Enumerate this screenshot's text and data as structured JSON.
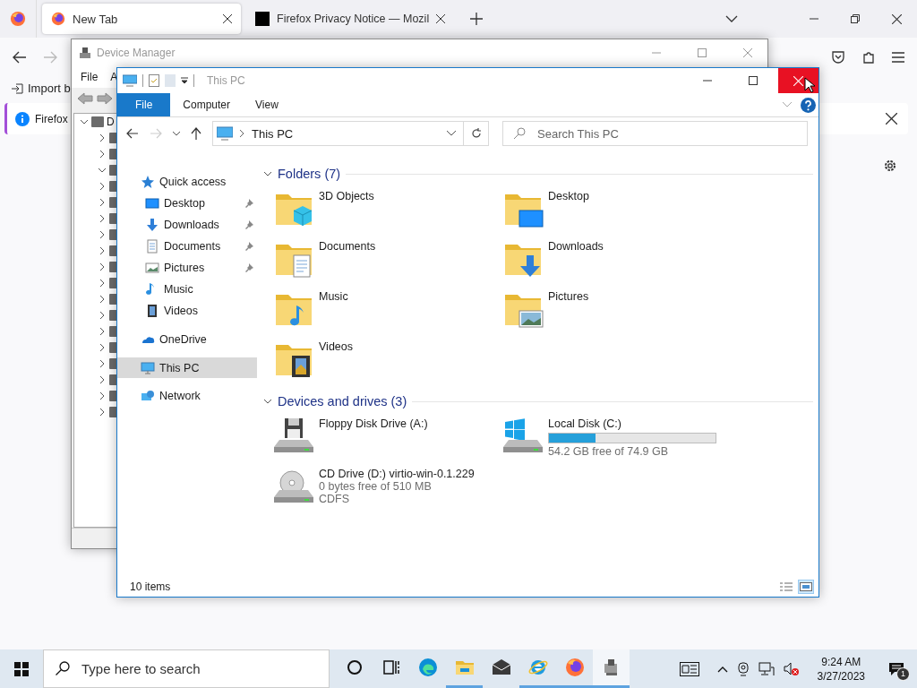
{
  "firefox": {
    "tabs": [
      {
        "title": "New Tab",
        "selected": true,
        "kind": "firefox"
      },
      {
        "title": "Firefox Privacy Notice — Mozil",
        "selected": false,
        "kind": "mozilla"
      }
    ],
    "bookmarks": [
      {
        "label": "Import b"
      }
    ],
    "notification": {
      "text": "Firefox"
    }
  },
  "device_manager": {
    "title": "Device Manager",
    "menu": [
      "File",
      "A"
    ],
    "tree": [
      {
        "label": "D",
        "expanded": true,
        "children": [
          {
            "expanded": false
          },
          {
            "expanded": false
          },
          {
            "expanded": true
          },
          {
            "expanded": false
          },
          {
            "expanded": false
          },
          {
            "expanded": false
          },
          {
            "expanded": false
          },
          {
            "expanded": false
          },
          {
            "expanded": false
          },
          {
            "expanded": false
          },
          {
            "expanded": false
          },
          {
            "expanded": false
          },
          {
            "expanded": false
          },
          {
            "expanded": false
          },
          {
            "expanded": false
          },
          {
            "expanded": false
          },
          {
            "expanded": false
          },
          {
            "expanded": false
          }
        ]
      }
    ]
  },
  "explorer": {
    "title": "This PC",
    "ribbon_tabs": [
      {
        "label": "File",
        "selected": true
      },
      {
        "label": "Computer",
        "selected": false
      },
      {
        "label": "View",
        "selected": false
      }
    ],
    "address": "This PC",
    "search": {
      "placeholder": "Search This PC"
    },
    "nav": [
      {
        "label": "Quick access",
        "kind": "quick",
        "selected": false,
        "children": [
          {
            "label": "Desktop",
            "kind": "desktop",
            "pinned": true,
            "selected": false
          },
          {
            "label": "Downloads",
            "kind": "downloads",
            "pinned": true,
            "selected": false
          },
          {
            "label": "Documents",
            "kind": "documents",
            "pinned": true,
            "selected": false
          },
          {
            "label": "Pictures",
            "kind": "pictures",
            "pinned": true,
            "selected": false
          },
          {
            "label": "Music",
            "kind": "music",
            "pinned": false,
            "selected": false
          },
          {
            "label": "Videos",
            "kind": "videos",
            "pinned": false,
            "selected": false
          }
        ]
      },
      {
        "label": "OneDrive",
        "kind": "onedrive",
        "selected": false
      },
      {
        "label": "This PC",
        "kind": "pc",
        "selected": true
      },
      {
        "label": "Network",
        "kind": "network",
        "selected": false
      }
    ],
    "groups": [
      {
        "title": "Folders (7)",
        "expanded": true,
        "items": [
          {
            "name": "3D Objects",
            "kind": "objects"
          },
          {
            "name": "Desktop",
            "kind": "desktop"
          },
          {
            "name": "Documents",
            "kind": "documents"
          },
          {
            "name": "Downloads",
            "kind": "downloads"
          },
          {
            "name": "Music",
            "kind": "music"
          },
          {
            "name": "Pictures",
            "kind": "pictures"
          },
          {
            "name": "Videos",
            "kind": "videos"
          }
        ]
      },
      {
        "title": "Devices and drives (3)",
        "expanded": true,
        "items": [
          {
            "name": "Floppy Disk Drive (A:)",
            "kind": "floppy"
          },
          {
            "name": "Local Disk (C:)",
            "kind": "disk",
            "level": 0.28,
            "details": [
              "54.2 GB free of 74.9 GB"
            ]
          },
          {
            "name": "CD Drive (D:) virtio-win-0.1.229",
            "kind": "cd",
            "details": [
              "0 bytes free of 510 MB",
              "CDFS"
            ]
          }
        ]
      }
    ],
    "status": "10 items",
    "view_buttons": [
      {
        "kind": "details",
        "selected": false
      },
      {
        "kind": "tiles",
        "selected": true
      }
    ]
  },
  "taskbar": {
    "search": {
      "placeholder": "Type here to search"
    },
    "buttons": [
      {
        "kind": "cortana",
        "running": false,
        "selected": false
      },
      {
        "kind": "taskview",
        "running": false,
        "selected": false
      },
      {
        "kind": "edge",
        "running": false,
        "selected": false
      },
      {
        "kind": "explorer",
        "running": true,
        "selected": false
      },
      {
        "kind": "mail",
        "running": false,
        "selected": false
      },
      {
        "kind": "ie",
        "running": true,
        "selected": false
      },
      {
        "kind": "firefox",
        "running": true,
        "selected": false
      },
      {
        "kind": "devmgr",
        "running": true,
        "selected": true
      }
    ],
    "time": "9:24 AM",
    "date": "3/27/2023",
    "notification_count": "1"
  }
}
